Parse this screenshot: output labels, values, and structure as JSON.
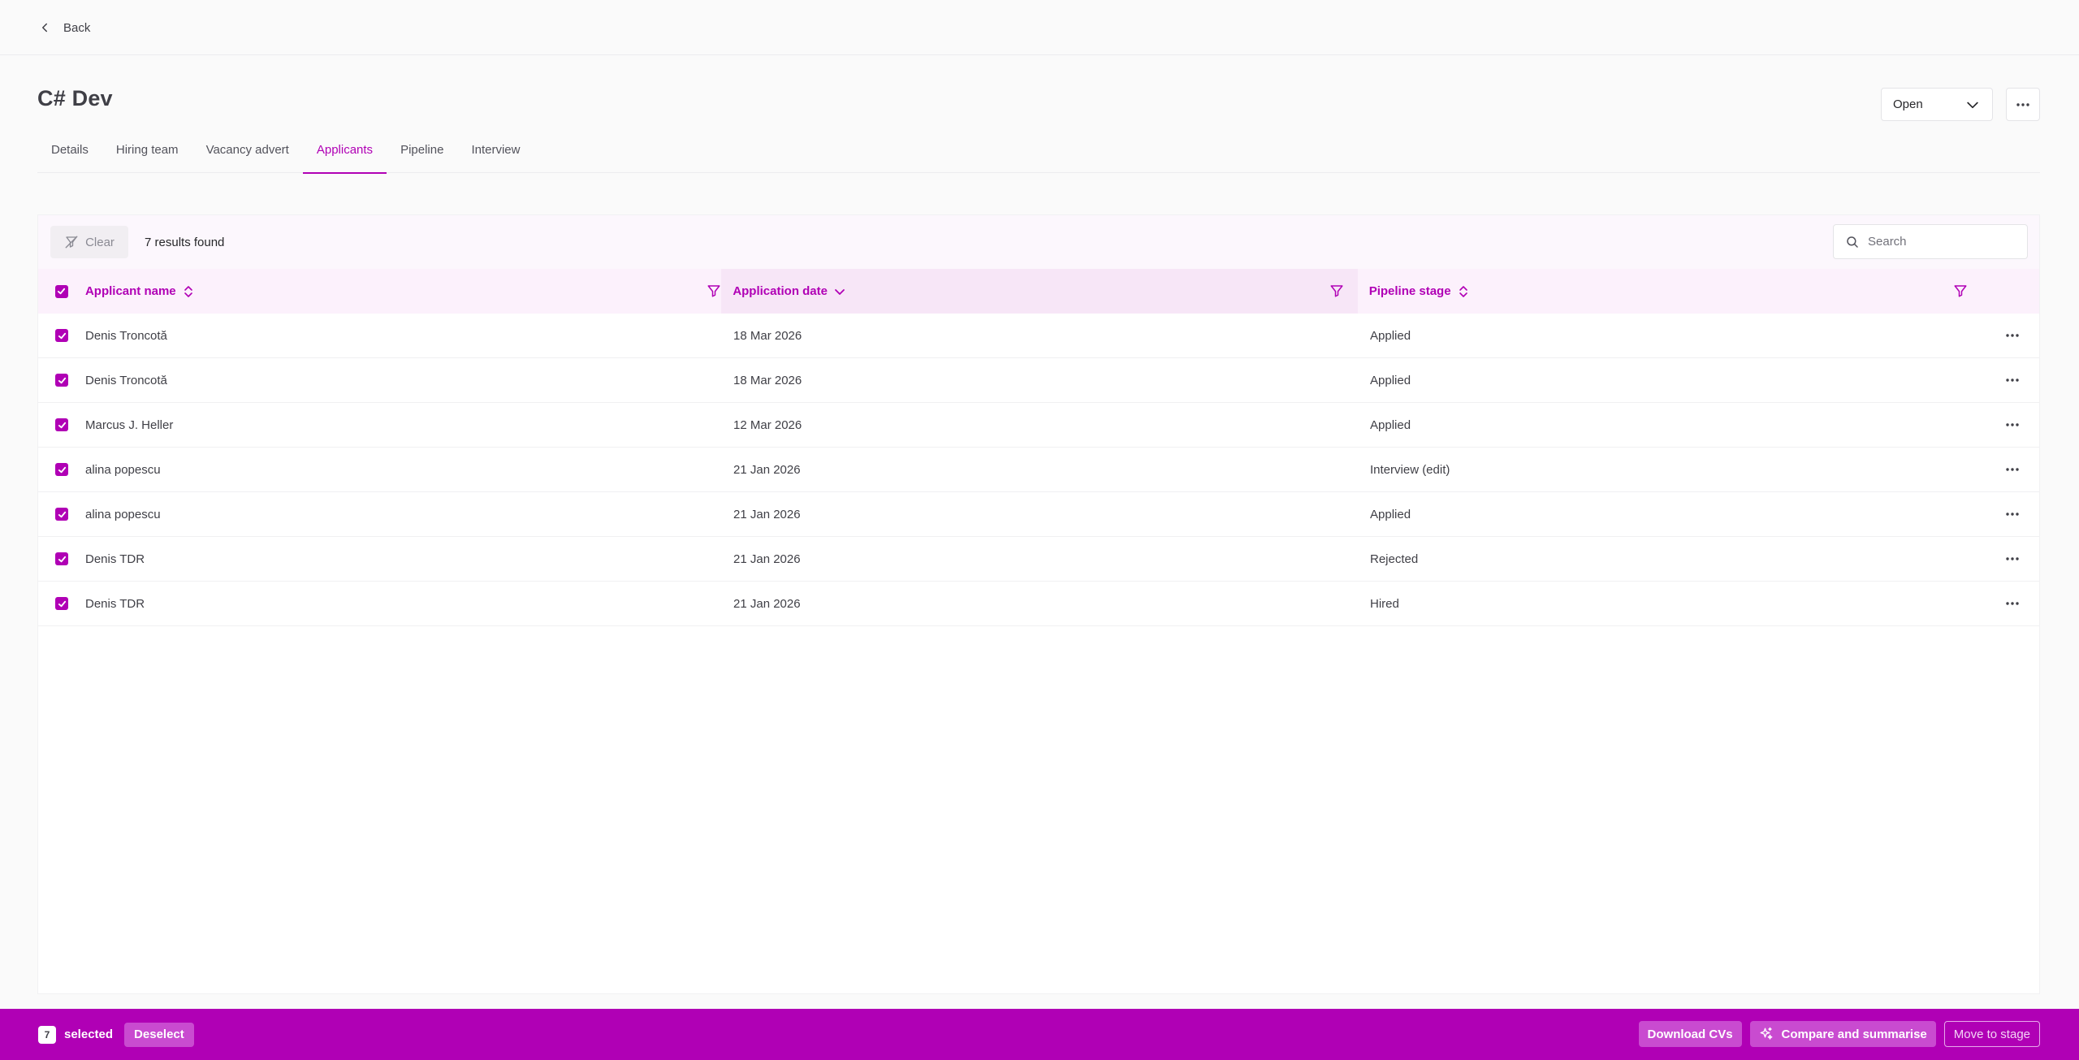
{
  "nav": {
    "back_label": "Back"
  },
  "job": {
    "title": "C# Dev",
    "status": "Open"
  },
  "tabs": [
    {
      "label": "Details",
      "active": false
    },
    {
      "label": "Hiring team",
      "active": false
    },
    {
      "label": "Vacancy advert",
      "active": false
    },
    {
      "label": "Applicants",
      "active": true
    },
    {
      "label": "Pipeline",
      "active": false
    },
    {
      "label": "Interview",
      "active": false
    }
  ],
  "toolbar": {
    "clear_label": "Clear",
    "results_text": "7 results found",
    "search_placeholder": "Search"
  },
  "table": {
    "columns": {
      "name": "Applicant name",
      "date": "Application date",
      "stage": "Pipeline stage"
    },
    "rows": [
      {
        "name": "Denis Troncotă",
        "date": "18 Mar 2026",
        "stage": "Applied"
      },
      {
        "name": "Denis Troncotă",
        "date": "18 Mar 2026",
        "stage": "Applied"
      },
      {
        "name": "Marcus J. Heller",
        "date": "12 Mar 2026",
        "stage": "Applied"
      },
      {
        "name": "alina popescu",
        "date": "21 Jan 2026",
        "stage": "Interview (edit)"
      },
      {
        "name": "alina popescu",
        "date": "21 Jan 2026",
        "stage": "Applied"
      },
      {
        "name": "Denis TDR",
        "date": "21 Jan 2026",
        "stage": "Rejected"
      },
      {
        "name": "Denis TDR",
        "date": "21 Jan 2026",
        "stage": "Hired"
      }
    ]
  },
  "selection": {
    "count": "7",
    "selected_label": "selected",
    "deselect_label": "Deselect",
    "download_label": "Download CVs",
    "compare_label": "Compare and summarise",
    "move_label": "Move to stage"
  },
  "colors": {
    "accent": "#b000b5",
    "header_bg": "#fcf1fc",
    "sorted_col_bg": "#f7e6f7"
  },
  "icons": [
    "chevron-left-icon",
    "chevron-down-icon",
    "more-horizontal-icon",
    "filter-clear-icon",
    "search-icon",
    "sort-icon",
    "filter-icon",
    "check-icon",
    "sparkle-icon"
  ]
}
